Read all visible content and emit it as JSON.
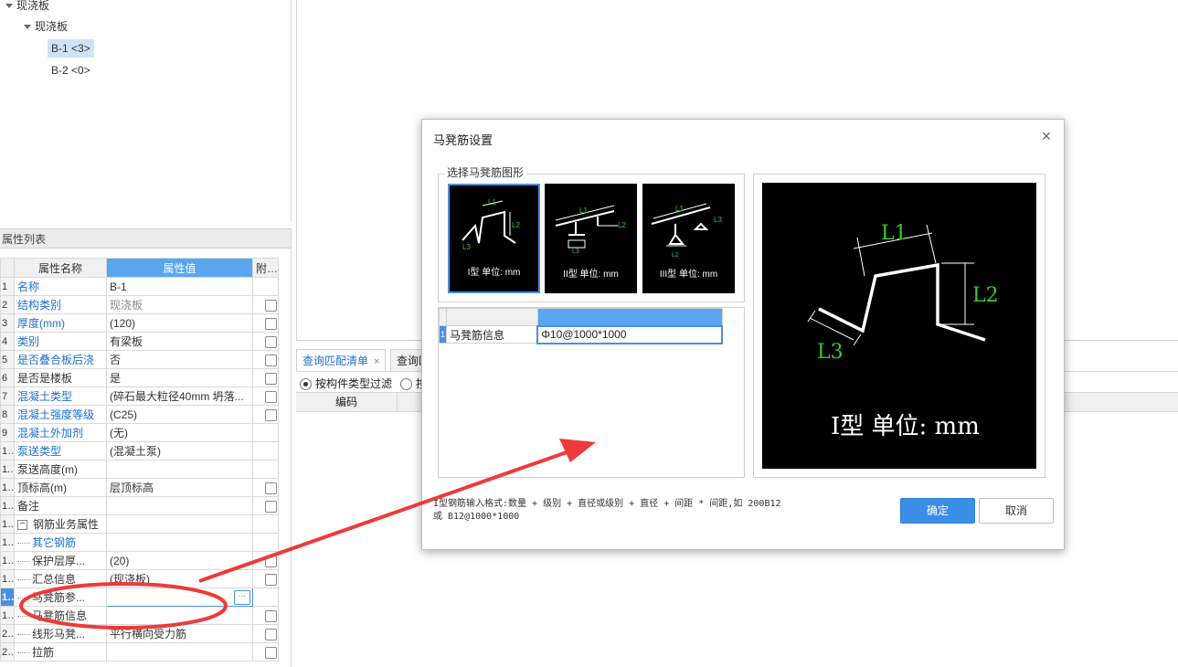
{
  "tree": {
    "root": "现浇板",
    "child": "现浇板",
    "leaves": [
      "B-1 <3>",
      "B-2 <0>"
    ]
  },
  "props": {
    "title": "属性列表",
    "headers": [
      "属性名称",
      "属性值",
      "附加"
    ],
    "rows": [
      {
        "n": "1",
        "name": "名称",
        "val": "B-1",
        "blue": true,
        "chk": false
      },
      {
        "n": "2",
        "name": "结构类别",
        "val": "现浇板",
        "blue": true,
        "gray": true,
        "chk": true
      },
      {
        "n": "3",
        "name": "厚度(mm)",
        "val": "(120)",
        "blue": true,
        "chk": true
      },
      {
        "n": "4",
        "name": "类别",
        "val": "有梁板",
        "blue": true,
        "chk": true
      },
      {
        "n": "5",
        "name": "是否叠合板后浇",
        "val": "否",
        "blue": true,
        "chk": true
      },
      {
        "n": "6",
        "name": "是否是楼板",
        "val": "是",
        "chk": true
      },
      {
        "n": "7",
        "name": "混凝土类型",
        "val": "(碎石最大粒径40mm 坍落...",
        "blue": true,
        "chk": true
      },
      {
        "n": "8",
        "name": "混凝土强度等级",
        "val": "(C25)",
        "blue": true,
        "chk": true
      },
      {
        "n": "9",
        "name": "混凝土外加剂",
        "val": "(无)",
        "blue": true,
        "chk": false
      },
      {
        "n": "10",
        "name": "泵送类型",
        "val": "(混凝土泵)",
        "blue": true,
        "chk": false
      },
      {
        "n": "11",
        "name": "泵送高度(m)",
        "val": "",
        "chk": false
      },
      {
        "n": "12",
        "name": "顶标高(m)",
        "val": "层顶标高",
        "chk": true
      },
      {
        "n": "13",
        "name": "备注",
        "val": "",
        "chk": true
      },
      {
        "n": "14",
        "name": "钢筋业务属性",
        "val": "",
        "group": true,
        "chk": false
      },
      {
        "n": "15",
        "name": "其它钢筋",
        "val": "",
        "blue": true,
        "indent": true,
        "chk": false
      },
      {
        "n": "16",
        "name": "保护层厚...",
        "val": "(20)",
        "indent": true,
        "chk": true
      },
      {
        "n": "17",
        "name": "汇总信息",
        "val": "(现浇板)",
        "indent": true,
        "chk": true
      },
      {
        "n": "18",
        "name": "马凳筋参...",
        "val": "",
        "indent": true,
        "edit": true,
        "current": true,
        "chk": false
      },
      {
        "n": "19",
        "name": "马凳筋信息",
        "val": "",
        "indent": true,
        "chk": true
      },
      {
        "n": "20",
        "name": "线形马凳...",
        "val": "平行横向受力筋",
        "indent": true,
        "chk": true
      },
      {
        "n": "21",
        "name": "拉筋",
        "val": "",
        "indent": true,
        "chk": true
      }
    ]
  },
  "lower": {
    "tab1": "查询匹配清单",
    "tab1_close": "×",
    "tab2": "查询匹",
    "filter1": "按构件类型过滤",
    "filter2": "按",
    "col_code": "编码"
  },
  "dialog": {
    "title": "马凳筋设置",
    "close": "×",
    "shape_group": "选择马凳筋图形",
    "thumbs": [
      {
        "label": "I型 单位: mm",
        "selected": true
      },
      {
        "label": "II型 单位: mm",
        "selected": false
      },
      {
        "label": "III型 单位: mm",
        "selected": false
      }
    ],
    "labels": {
      "L1": "L1",
      "L2": "L2",
      "L3": "L3"
    },
    "info_row_num": "1",
    "info_name": "马凳筋信息",
    "info_value": "Φ10@1000*1000",
    "preview_label": "I型 单位: mm",
    "hint_line1": "I型钢筋输入格式:数量 + 级别 + 直径或级别 + 直径 + 间距 * 间距,如 200B12",
    "hint_line2": "或 B12@1000*1000",
    "ok": "确定",
    "cancel": "取消"
  },
  "colors": {
    "accent": "#3b8ee6",
    "annotation": "#ee3a3a",
    "steel": "#ffffff",
    "dim_label": "#33cc33"
  }
}
